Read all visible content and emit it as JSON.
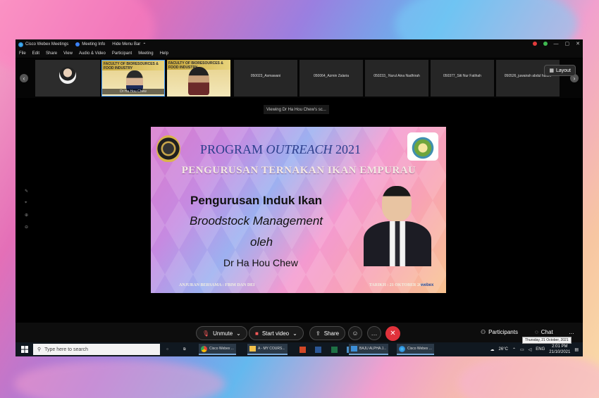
{
  "window": {
    "app_title": "Cisco Webex Meetings",
    "meeting_info": "Meeting Info",
    "hide_menu_bar": "Hide Menu Bar",
    "colors": {
      "accent": "#e0323b",
      "webex_green": "#3fb950"
    }
  },
  "menu": [
    "File",
    "Edit",
    "Share",
    "View",
    "Audio & Video",
    "Participant",
    "Meeting",
    "Help"
  ],
  "participants_strip": {
    "tiles": [
      {
        "name": ""
      },
      {
        "name": "Dr Ha Hou Chew",
        "banner": "FACULTY OF BIORESOURCES & FOOD INDUSTRY"
      },
      {
        "name": "",
        "banner": "FACULTY OF BIORESOURCES & FOOD INDUSTRY"
      },
      {
        "name": "050023_Asmawani"
      },
      {
        "name": "050064_Azmin Zalaria"
      },
      {
        "name": "050233_ Nurul Aina Nadhirah"
      },
      {
        "name": "050377_Siti Nur Fatihah"
      },
      {
        "name": "050526_juwairah abdul hakim"
      }
    ],
    "layout_button": "Layout"
  },
  "viewing_banner": "Viewing Dr Ha Hou Chew's sc...",
  "slide": {
    "title_prefix": "PROGRAM",
    "title_italic": "OUTREACH",
    "title_year": "2021",
    "subtitle": "PENGURUSAN TERNAKAN IKAN EMPURAU",
    "line1": "Pengurusan Induk Ikan",
    "line2": "Broodstock Management",
    "line3": "oleh",
    "line4": "Dr Ha Hou Chew",
    "footer_left": "ANJURAN BERSAMA : FBIM DAN DEI",
    "footer_right": "TARIKH : 21 OKTOBER 2021",
    "watermark": "webex"
  },
  "controls": {
    "unmute": "Unmute",
    "start_video": "Start video",
    "share": "Share",
    "participants": "Participants",
    "chat": "Chat"
  },
  "taskbar": {
    "search_placeholder": "Type here to search",
    "apps": [
      {
        "label": "Cisco Webex ...",
        "icon": "chrome-icon"
      },
      {
        "label": "A - MY COURS...",
        "icon": "folder-icon"
      },
      {
        "label": "BAJU ALPHA J...",
        "icon": "photos-icon"
      },
      {
        "label": "Cisco Webex ...",
        "icon": "webex-icon"
      }
    ],
    "weather": "26°C",
    "lang": "ENG",
    "time": "2:01 PM",
    "date": "21/10/2021",
    "tooltip": "Thursday, 21 October, 2021"
  }
}
